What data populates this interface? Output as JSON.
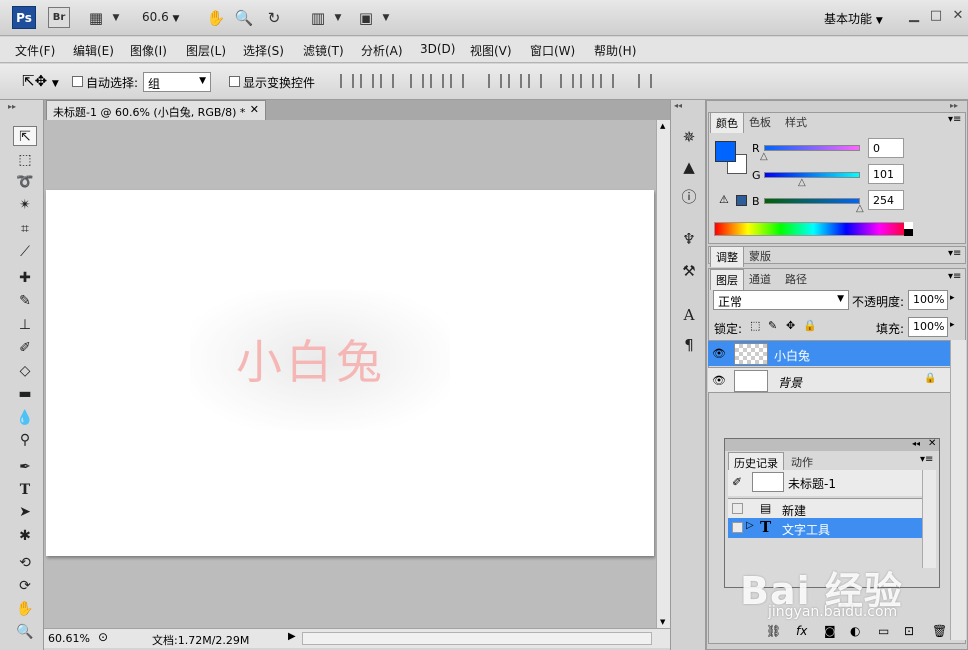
{
  "titlebar": {
    "app_logo": "Ps",
    "bridge_logo": "Br",
    "zoom_value": "60.6",
    "workspace": "基本功能",
    "icons": [
      "film-icon",
      "hand-icon",
      "zoom-icon",
      "rotate-view-icon",
      "arrange-icon",
      "screen-mode-icon"
    ]
  },
  "menu": {
    "items": [
      "文件(F)",
      "编辑(E)",
      "图像(I)",
      "图层(L)",
      "选择(S)",
      "滤镜(T)",
      "分析(A)",
      "3D(D)",
      "视图(V)",
      "窗口(W)",
      "帮助(H)"
    ]
  },
  "options": {
    "auto_select_label": "自动选择:",
    "auto_select_value": "组",
    "show_transform_label": "显示变换控件"
  },
  "document": {
    "tab_title": "未标题-1 @ 60.6% (小白兔, RGB/8) *",
    "canvas_text": "小白兔",
    "text_color": "#f5b7b5",
    "zoom_status": "60.61%",
    "doc_size": "文档:1.72M/2.29M"
  },
  "color_panel": {
    "tabs": [
      "颜色",
      "色板",
      "样式"
    ],
    "foreground": "#0065fe",
    "background": "#ffffff",
    "r_label": "R",
    "r_value": "0",
    "g_label": "G",
    "g_value": "101",
    "b_label": "B",
    "b_value": "254"
  },
  "adjust_panel": {
    "tabs": [
      "调整",
      "蒙版"
    ]
  },
  "layers_panel": {
    "tabs": [
      "图层",
      "通道",
      "路径"
    ],
    "blend_mode": "正常",
    "opacity_label": "不透明度:",
    "opacity_value": "100%",
    "lock_label": "锁定:",
    "fill_label": "填充:",
    "fill_value": "100%",
    "layers": [
      {
        "name": "小白兔",
        "selected": true
      },
      {
        "name": "背景",
        "selected": false
      }
    ]
  },
  "history_panel": {
    "tabs": [
      "历史记录",
      "动作"
    ],
    "snapshot": "未标题-1",
    "steps": [
      "新建",
      "文字工具"
    ]
  },
  "watermark": {
    "main": "Bai 经验",
    "sub": "jingyan.baidu.com"
  }
}
